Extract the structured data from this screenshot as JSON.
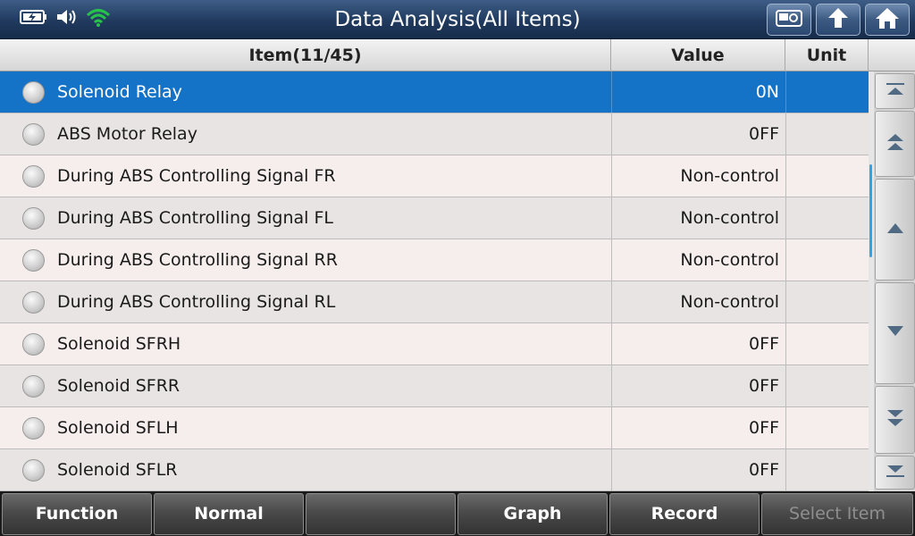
{
  "window": {
    "title": "Data Analysis(All Items)",
    "status_icons": [
      "battery-charging-icon",
      "speaker-icon",
      "wifi-icon"
    ],
    "title_buttons": [
      "screenshot-icon",
      "back-arrow-icon",
      "home-icon"
    ]
  },
  "table": {
    "headers": {
      "item": "Item(11/45)",
      "value": "Value",
      "unit": "Unit"
    },
    "rows": [
      {
        "name": "Solenoid Relay",
        "value": "0N",
        "unit": "",
        "selected": true
      },
      {
        "name": "ABS Motor Relay",
        "value": "0FF",
        "unit": ""
      },
      {
        "name": "During ABS Controlling Signal FR",
        "value": "Non-control",
        "unit": ""
      },
      {
        "name": "During ABS Controlling Signal FL",
        "value": "Non-control",
        "unit": ""
      },
      {
        "name": "During ABS Controlling Signal RR",
        "value": "Non-control",
        "unit": ""
      },
      {
        "name": "During ABS Controlling Signal RL",
        "value": "Non-control",
        "unit": ""
      },
      {
        "name": "Solenoid SFRH",
        "value": "0FF",
        "unit": ""
      },
      {
        "name": "Solenoid SFRR",
        "value": "0FF",
        "unit": ""
      },
      {
        "name": "Solenoid SFLH",
        "value": "0FF",
        "unit": ""
      },
      {
        "name": "Solenoid SFLR",
        "value": "0FF",
        "unit": ""
      }
    ],
    "selected_color": "#1573c7"
  },
  "scroll_buttons": [
    "scroll-top-icon",
    "page-up-icon",
    "line-up-icon",
    "line-down-icon",
    "page-down-icon",
    "scroll-bottom-icon"
  ],
  "bottom_bar": {
    "function": "Function",
    "normal": "Normal",
    "blank": "",
    "graph": "Graph",
    "record": "Record",
    "select_item": "Select Item"
  }
}
